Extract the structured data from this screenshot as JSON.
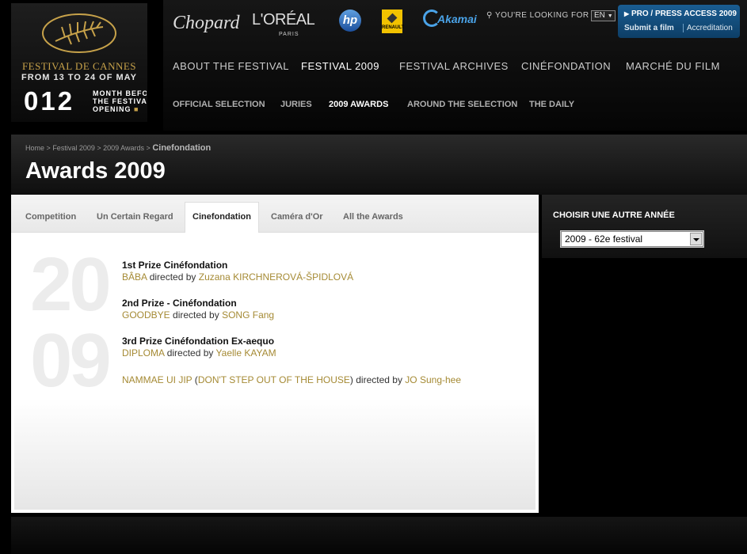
{
  "logo": {
    "festival_name": "FESTIVAL DE CANNES",
    "dates": "FROM 13 TO 24 OF MAY",
    "countdown_number": "012",
    "countdown_lines": [
      "MONTH BEFORE",
      "THE FESTIVAL",
      "OPENING"
    ]
  },
  "sponsors": {
    "chopard": "Chopard",
    "loreal": "L'ORÉAL",
    "loreal_sub": "PARIS",
    "hp": "hp",
    "renault": "RENAULT",
    "akamai": "Akamai"
  },
  "search": {
    "hint": "YOU'RE LOOKING FOR"
  },
  "language": {
    "selected": "EN"
  },
  "pro": {
    "title": "PRO / PRESS ACCESS 2009",
    "submit": "Submit a film",
    "accreditation": "Accreditation"
  },
  "main_nav": [
    {
      "label": "ABOUT THE FESTIVAL"
    },
    {
      "label": "FESTIVAL 2009"
    },
    {
      "label": "FESTIVAL ARCHIVES"
    },
    {
      "label": "CINÉFONDATION"
    },
    {
      "label": "MARCHÉ DU FILM"
    }
  ],
  "sub_nav": [
    {
      "label": "OFFICIAL SELECTION"
    },
    {
      "label": "JURIES"
    },
    {
      "label": "2009 AWARDS"
    },
    {
      "label": "AROUND THE SELECTION"
    },
    {
      "label": "THE DAILY"
    }
  ],
  "breadcrumb": {
    "items": [
      "Home",
      "Festival 2009",
      "2009 Awards"
    ],
    "separator": ">",
    "current": "Cinefondation"
  },
  "page_title": "Awards 2009",
  "tabs": [
    {
      "label": "Competition"
    },
    {
      "label": "Un Certain Regard"
    },
    {
      "label": "Cinefondation"
    },
    {
      "label": "Caméra d'Or"
    },
    {
      "label": "All the Awards"
    }
  ],
  "year_bg": {
    "top": "20",
    "bottom": "09"
  },
  "awards": [
    {
      "title": "1st Prize Cinéfondation",
      "film": "BÂBA",
      "directed_by": "directed by",
      "director": "Zuzana KIRCHNEROVÁ-ŠPIDLOVÁ"
    },
    {
      "title": "2nd Prize - Cinéfondation",
      "film": "GOODBYE",
      "directed_by": "directed by",
      "director": "SONG Fang"
    },
    {
      "title": "3rd Prize Cinéfondation Ex-aequo",
      "film": "DIPLOMA",
      "directed_by": "directed by",
      "director": "Yaelle KAYAM"
    },
    {
      "film": "NAMMAE UI JIP",
      "paren_open": " (",
      "film_alt": "DON'T STEP OUT OF THE HOUSE",
      "paren_close": ")",
      "directed_by": " directed by ",
      "director": "JO Sung-hee"
    }
  ],
  "sidebar": {
    "label": "CHOISIR UNE AUTRE ANNÉE",
    "selected_year": "2009 - 62e festival"
  }
}
